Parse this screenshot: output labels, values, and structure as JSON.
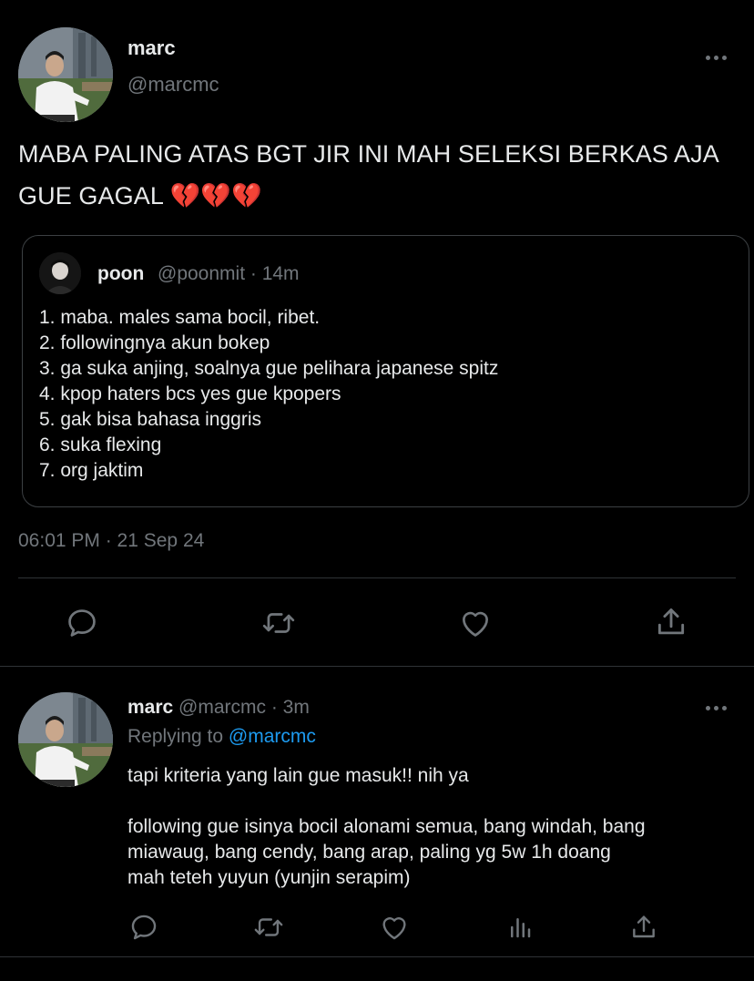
{
  "main_tweet": {
    "author_name": "marc",
    "author_handle": "@marcmc",
    "text": "MABA PALING ATAS BGT JIR INI MAH SELEKSI BERKAS AJA GUE GAGAL 💔💔💔",
    "more_icon": "more-horizontal-icon",
    "timestamp": "06:01 PM · 21 Sep 24",
    "quote": {
      "author_name": "poon",
      "meta": "@poonmit · 14m",
      "lines": [
        "1. maba. males sama bocil, ribet.",
        "2. followingnya akun bokep",
        "3. ga suka anjing, soalnya gue pelihara japanese spitz",
        "4. kpop haters bcs yes gue kpopers",
        "5. gak bisa bahasa inggris",
        "6. suka flexing",
        "7. org jaktim"
      ]
    },
    "actions": [
      "reply-icon",
      "retweet-icon",
      "like-icon",
      "share-icon"
    ]
  },
  "reply_tweet": {
    "author_name": "marc",
    "meta": "@marcmc · 3m",
    "replying_label": "Replying to",
    "replying_handle": "@marcmc",
    "text_lines": [
      "tapi kriteria yang lain gue masuk!! nih ya",
      "",
      "following gue isinya bocil alonami semua, bang windah, bang",
      "miawaug, bang cendy, bang arap, paling yg 5w 1h doang",
      "mah teteh yuyun (yunjin serapim)"
    ],
    "actions": [
      "reply-icon",
      "retweet-icon",
      "like-icon",
      "analytics-icon",
      "share-icon"
    ]
  },
  "colors": {
    "background": "#000000",
    "text_primary": "#e7e9ea",
    "text_secondary": "#71767b",
    "link": "#1d9bf0",
    "border": "#2f3336"
  }
}
